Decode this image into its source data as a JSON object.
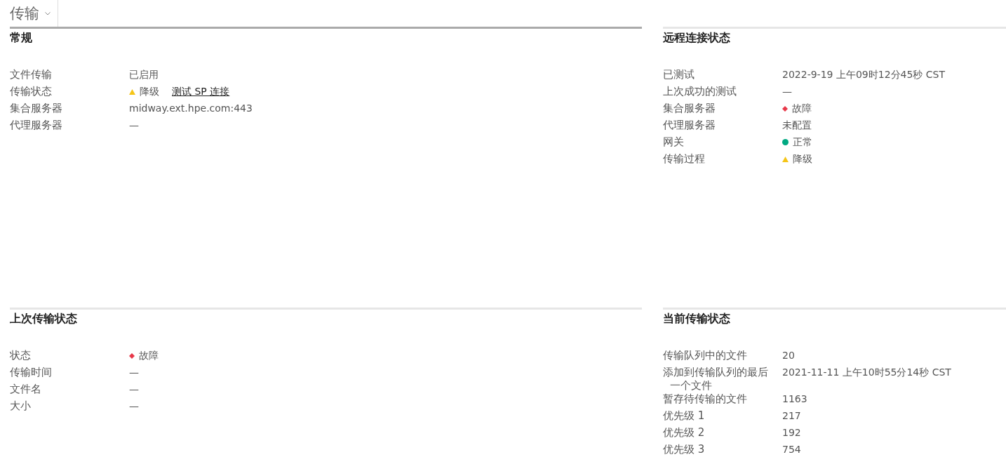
{
  "header": {
    "title": "传输"
  },
  "sections": [
    {
      "title": "常规",
      "emphasized": true,
      "rows": [
        {
          "label": "文件传输",
          "value": "已启用",
          "kind": "plain"
        },
        {
          "label": "传输状态",
          "value": "降级",
          "kind": "warning",
          "link": "测试 SP 连接"
        },
        {
          "label": "集合服务器",
          "value": "midway.ext.hpe.com:443",
          "kind": "plain"
        },
        {
          "label": "代理服务器",
          "value": "—",
          "kind": "plain"
        }
      ]
    },
    {
      "title": "远程连接状态",
      "emphasized": false,
      "rows": [
        {
          "label": "已测试",
          "value": "2022-9-19 上午09时12分45秒 CST",
          "kind": "plain"
        },
        {
          "label": "上次成功的测试",
          "value": "—",
          "kind": "plain"
        },
        {
          "label": "集合服务器",
          "value": "故障",
          "kind": "critical"
        },
        {
          "label": "代理服务器",
          "value": "未配置",
          "kind": "plain"
        },
        {
          "label": "网关",
          "value": "正常",
          "kind": "ok"
        },
        {
          "label": "传输过程",
          "value": "降级",
          "kind": "warning"
        }
      ]
    },
    {
      "title": "上次传输状态",
      "emphasized": false,
      "rows": [
        {
          "label": "状态",
          "value": "故障",
          "kind": "critical"
        },
        {
          "label": "传输时间",
          "value": "—",
          "kind": "plain"
        },
        {
          "label": "文件名",
          "value": "—",
          "kind": "plain"
        },
        {
          "label": "大小",
          "value": "—",
          "kind": "plain"
        }
      ]
    },
    {
      "title": "当前传输状态",
      "emphasized": false,
      "rows": [
        {
          "label": "传输队列中的文件",
          "value": "20",
          "kind": "plain"
        },
        {
          "label": "添加到传输队列的最后一个文件",
          "value": "2021-11-11 上午10时55分14秒 CST",
          "kind": "plain"
        },
        {
          "label": "暂存待传输的文件",
          "value": "1163",
          "kind": "plain"
        },
        {
          "label": "优先级 1",
          "value": "217",
          "kind": "plain"
        },
        {
          "label": "优先级 2",
          "value": "192",
          "kind": "plain"
        },
        {
          "label": "优先级 3",
          "value": "754",
          "kind": "plain"
        }
      ]
    }
  ]
}
